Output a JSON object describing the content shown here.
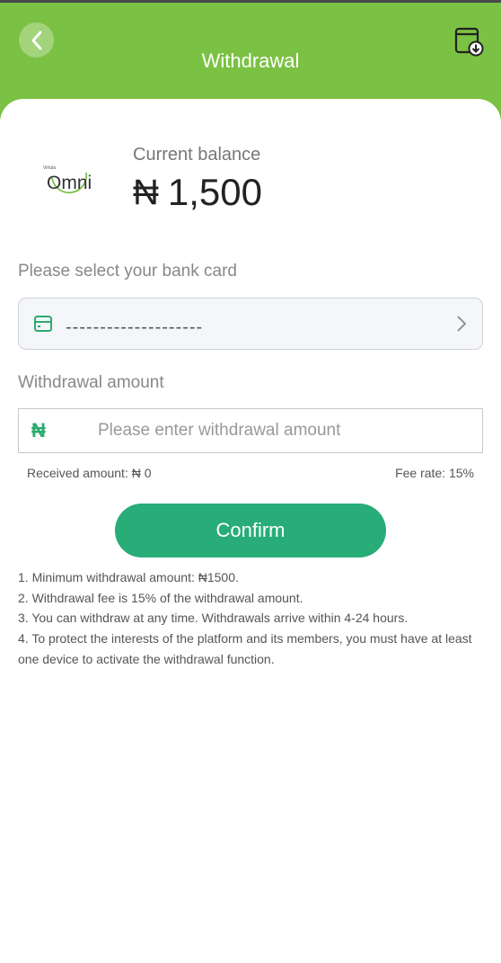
{
  "header": {
    "title": "Withdrawal",
    "back_icon": "chevron-left-icon",
    "record_icon": "wallet-download-icon",
    "color": "#7bc143"
  },
  "balance": {
    "logo_small_text": "Virtula",
    "logo_text": "Omni",
    "label": "Current balance",
    "currency": "₦",
    "amount": "1,500"
  },
  "bank_card": {
    "label": "Please select your bank card",
    "value": "------‐-------------",
    "icon": "credit-card-icon"
  },
  "withdrawal": {
    "label": "Withdrawal amount",
    "currency_icon": "₦",
    "placeholder": "Please enter withdrawal amount",
    "received": "Received amount: ₦ 0",
    "fee_rate": "Fee rate: 15%"
  },
  "confirm": {
    "label": "Confirm",
    "color": "#28ad78"
  },
  "rules": [
    "1. Minimum withdrawal amount: ₦1500.",
    "2. Withdrawal fee is 15% of the withdrawal amount.",
    "3. You can withdraw at any time. Withdrawals arrive within 4-24 hours.",
    "4. To protect the interests of the platform and its members, you must have at least one device to activate the withdrawal function."
  ]
}
